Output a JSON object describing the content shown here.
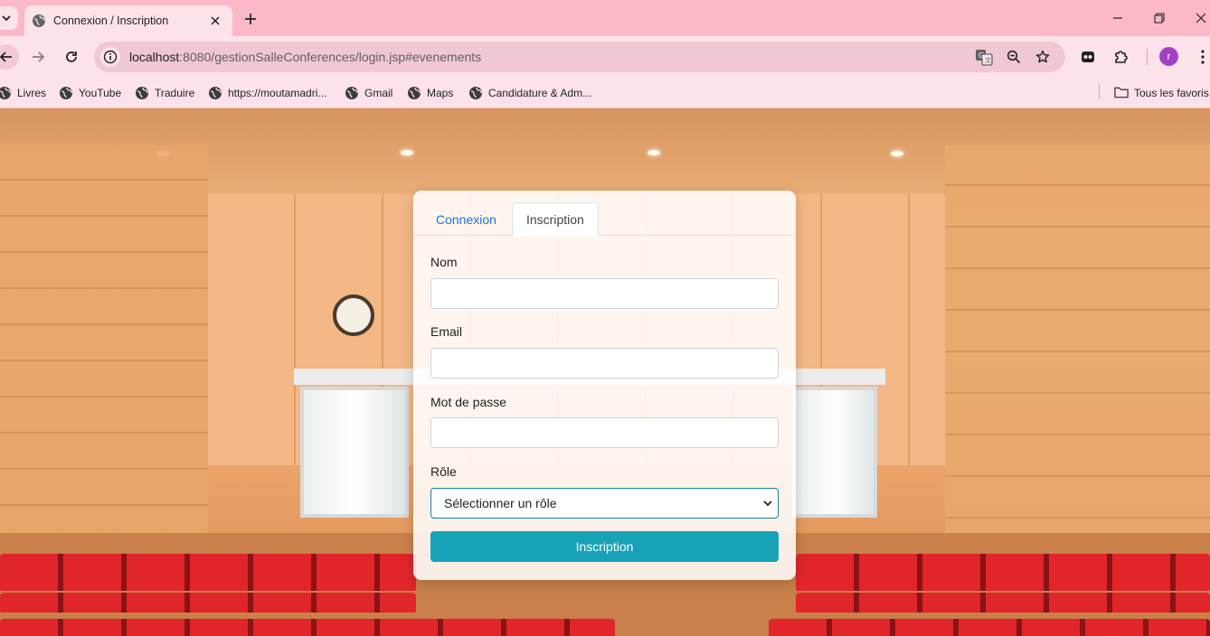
{
  "browser": {
    "tab": {
      "title": "Connexion / Inscription"
    },
    "address": {
      "host": "localhost",
      "path": ":8080/gestionSalleConferences/login.jsp#evenements"
    },
    "profile_initial": "r",
    "bookmarks": [
      "Livres",
      "YouTube",
      "Traduire",
      "https://moutamadri...",
      "Gmail",
      "Maps",
      "Candidature & Adm..."
    ],
    "all_bookmarks": "Tous les favoris"
  },
  "icons": {
    "tab_search": "chevron-down-icon",
    "favicon": "globe-icon",
    "tab_close": "close-icon",
    "new_tab": "plus-icon",
    "minimize": "minimize-icon",
    "restore": "restore-icon",
    "close_window": "close-icon",
    "back": "arrow-left-icon",
    "forward": "arrow-right-icon",
    "reload": "reload-icon",
    "site_info": "info-icon",
    "translate": "translate-icon",
    "zoom": "zoom-icon",
    "bookmark_star": "star-icon",
    "extension_app": "extension-app-icon",
    "extensions": "puzzle-icon",
    "menu": "kebab-menu-icon",
    "folder": "folder-icon",
    "select_caret": "chevron-down-icon"
  },
  "form": {
    "tabs": [
      {
        "label": "Connexion",
        "active": false
      },
      {
        "label": "Inscription",
        "active": true
      }
    ],
    "fields": {
      "nom": {
        "label": "Nom",
        "value": ""
      },
      "email": {
        "label": "Email",
        "value": ""
      },
      "password": {
        "label": "Mot de passe",
        "value": ""
      },
      "role": {
        "label": "Rôle",
        "selected": "Sélectionner un rôle"
      }
    },
    "submit_label": "Inscription"
  },
  "colors": {
    "tab_strip": "#fbb9c8",
    "toolbar": "#fde3e9",
    "link": "#1c73d9",
    "submit_button": "#17a2b8",
    "select_border": "#1a7ea6",
    "avatar": "#a142c4"
  }
}
